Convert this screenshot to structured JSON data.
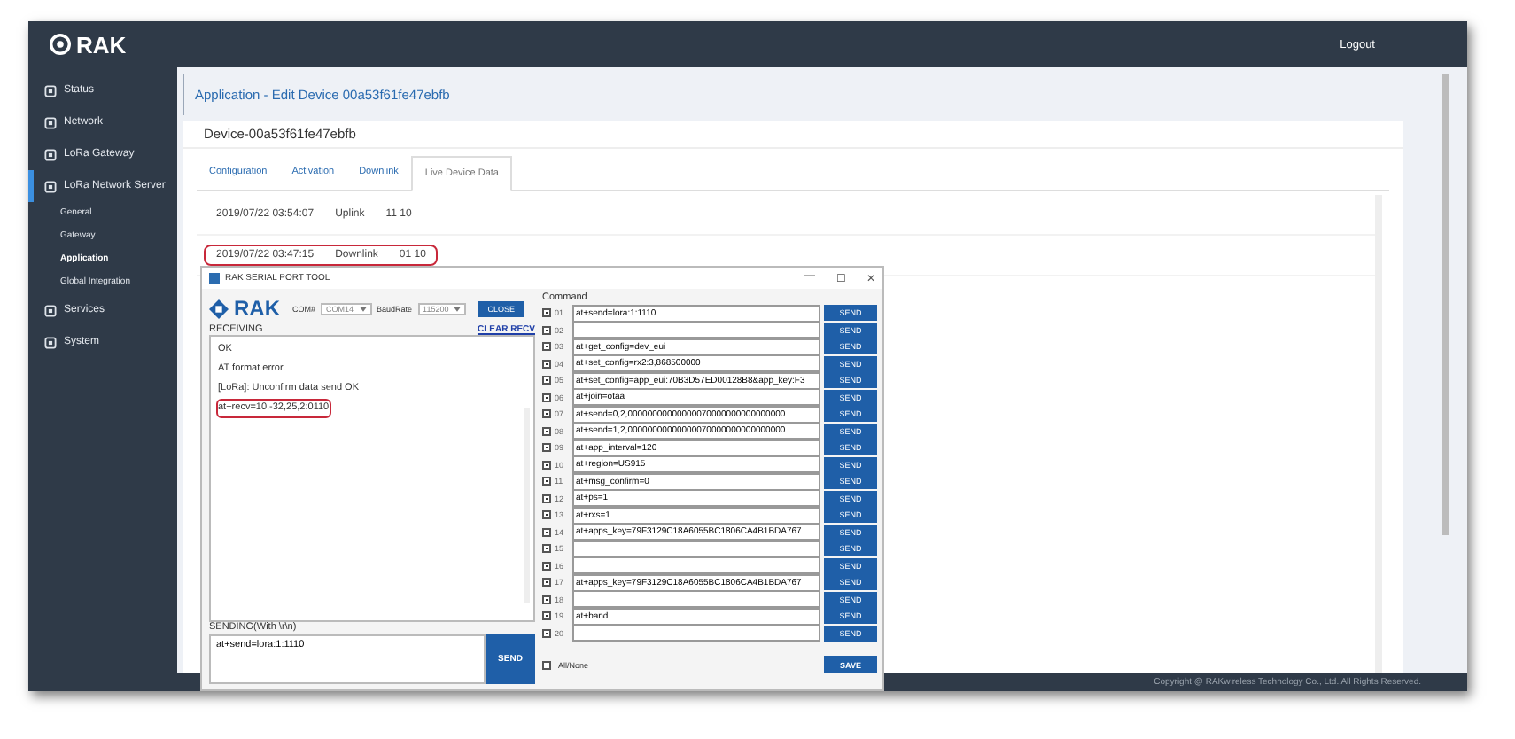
{
  "header": {
    "logo": "RAK",
    "logout": "Logout"
  },
  "sidebar": {
    "items": [
      {
        "label": "Status",
        "selected": false
      },
      {
        "label": "Network",
        "selected": false
      },
      {
        "label": "LoRa Gateway",
        "selected": false
      },
      {
        "label": "LoRa Network Server",
        "selected": true,
        "children": [
          {
            "label": "General",
            "selected": false
          },
          {
            "label": "Gateway",
            "selected": false
          },
          {
            "label": "Application",
            "selected": true
          },
          {
            "label": "Global Integration",
            "selected": false
          }
        ]
      },
      {
        "label": "Services",
        "selected": false
      },
      {
        "label": "System",
        "selected": false
      }
    ]
  },
  "page_title": "Application - Edit Device 00a53f61fe47ebfb",
  "device_name": "Device-00a53f61fe47ebfb",
  "tabs": [
    {
      "label": "Configuration",
      "selected": false
    },
    {
      "label": "Activation",
      "selected": false
    },
    {
      "label": "Downlink",
      "selected": false
    },
    {
      "label": "Live Device Data",
      "selected": true
    }
  ],
  "live_data": [
    {
      "time": "2019/07/22 03:54:07",
      "direction": "Uplink",
      "payload": "11 10",
      "highlighted": false
    },
    {
      "time": "2019/07/22 03:47:15",
      "direction": "Downlink",
      "payload": "01 10",
      "highlighted": true
    }
  ],
  "footer": "Copyright @ RAKwireless Technology Co., Ltd. All Rights Reserved.",
  "serial_tool": {
    "title": "RAK SERIAL PORT TOOL",
    "window_controls": [
      "—",
      "☐",
      "✕"
    ],
    "logo": "RAK",
    "com_label": "COM#",
    "com_value": "COM14",
    "baud_label": "BaudRate",
    "baud_value": "115200",
    "close_button": "CLOSE",
    "receiving_label": "RECEIVING",
    "clear_link": "CLEAR RECV",
    "received_lines": [
      {
        "text": "OK",
        "highlighted": false
      },
      {
        "text": "AT format error.",
        "highlighted": false
      },
      {
        "text": "[LoRa]: Unconfirm data send OK",
        "highlighted": false
      },
      {
        "text": "at+recv=10,-32,25,2:0110",
        "highlighted": true
      }
    ],
    "sending_label": "SENDING(With \\r\\n)",
    "send_value": "at+send=lora:1:1110",
    "send_button": "SEND",
    "command_label": "Command",
    "commands": [
      {
        "number": "01",
        "text": "at+send=lora:1:1110",
        "checked": true,
        "button": "SEND"
      },
      {
        "number": "02",
        "checked": true,
        "button": "SEND"
      },
      {
        "number": "03",
        "text": "at+get_config=dev_eui",
        "checked": true,
        "button": "SEND"
      },
      {
        "number": "04",
        "text": "at+set_config=rx2:3,868500000",
        "checked": true,
        "button": "SEND"
      },
      {
        "number": "05",
        "text": "at+set_config=app_eui:70B3D57ED00128B8&app_key:F3",
        "checked": true,
        "button": "SEND"
      },
      {
        "number": "06",
        "text": "at+join=otaa",
        "checked": true,
        "button": "SEND"
      },
      {
        "number": "07",
        "text": "at+send=0,2,00000000000000070000000000000000",
        "checked": true,
        "button": "SEND"
      },
      {
        "number": "08",
        "text": "at+send=1,2,00000000000000070000000000000000",
        "checked": true,
        "button": "SEND"
      },
      {
        "number": "09",
        "text": "at+app_interval=120",
        "checked": true,
        "button": "SEND"
      },
      {
        "number": "10",
        "text": "at+region=US915",
        "checked": true,
        "button": "SEND"
      },
      {
        "number": "11",
        "text": "at+msg_confirm=0",
        "checked": true,
        "button": "SEND"
      },
      {
        "number": "12",
        "text": "at+ps=1",
        "checked": true,
        "button": "SEND"
      },
      {
        "number": "13",
        "text": "at+rxs=1",
        "checked": true,
        "button": "SEND"
      },
      {
        "number": "14",
        "text": "at+apps_key=79F3129C18A6055BC1806CA4B1BDA767",
        "checked": true,
        "button": "SEND"
      },
      {
        "number": "15",
        "checked": true,
        "button": "SEND"
      },
      {
        "number": "16",
        "checked": true,
        "button": "SEND"
      },
      {
        "number": "17",
        "text": "at+apps_key=79F3129C18A6055BC1806CA4B1BDA767",
        "checked": true,
        "button": "SEND"
      },
      {
        "number": "18",
        "checked": true,
        "button": "SEND"
      },
      {
        "number": "19",
        "text": "at+band",
        "checked": true,
        "button": "SEND"
      },
      {
        "number": "20",
        "checked": true,
        "button": "SEND"
      }
    ],
    "all_none": {
      "label": "All/None",
      "checked": false
    },
    "save_button": "SAVE"
  }
}
